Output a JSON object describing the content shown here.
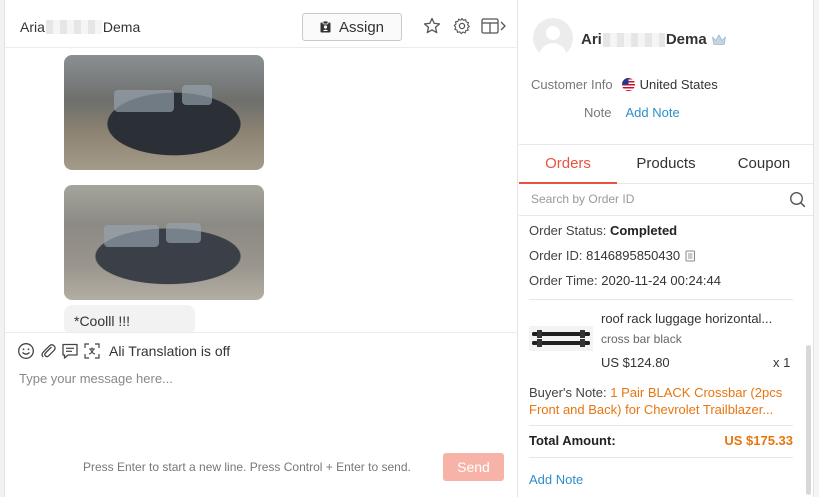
{
  "chat": {
    "contact_name_start": "Aria",
    "contact_name_end": "Dema",
    "assign_label": "Assign",
    "messages": [
      {
        "type": "image",
        "icon": "car-photo"
      },
      {
        "type": "image",
        "icon": "car-photo"
      },
      {
        "type": "text",
        "text": "*Coolll !!!"
      }
    ],
    "translation_status": "Ali Translation is off",
    "input_placeholder": "Type your message here...",
    "hint": "Press Enter to start a new line. Press Control + Enter to send.",
    "send_label": "Send"
  },
  "customer": {
    "name_start": "Ari",
    "name_end": "Dema",
    "info_label": "Customer Info",
    "country": "United States",
    "note_label": "Note",
    "add_note": "Add Note"
  },
  "tabs": [
    {
      "label": "Orders",
      "active": true
    },
    {
      "label": "Products",
      "active": false
    },
    {
      "label": "Coupon",
      "active": false
    }
  ],
  "search": {
    "placeholder": "Search by Order ID"
  },
  "order": {
    "status_label": "Order Status:",
    "status": "Completed",
    "id_label": "Order ID:",
    "id": "8146895850430",
    "time_label": "Order Time:",
    "time": "2020-11-24 00:24:44",
    "product": {
      "title": "roof rack luggage horizontal...",
      "sku": "cross bar black",
      "price": "US $124.80",
      "qty": "x 1"
    },
    "buyer_note_label": "Buyer's Note:",
    "buyer_note": "1 Pair BLACK Crossbar (2pcs Front and Back) for Chevrolet Trailblazer...",
    "total_label": "Total Amount:",
    "total": "US $175.33",
    "add_note": "Add Note"
  },
  "colors": {
    "accent": "#e8523f",
    "link": "#2e8ecb",
    "price": "#e8750f",
    "send_disabled": "#f7b3a8"
  }
}
